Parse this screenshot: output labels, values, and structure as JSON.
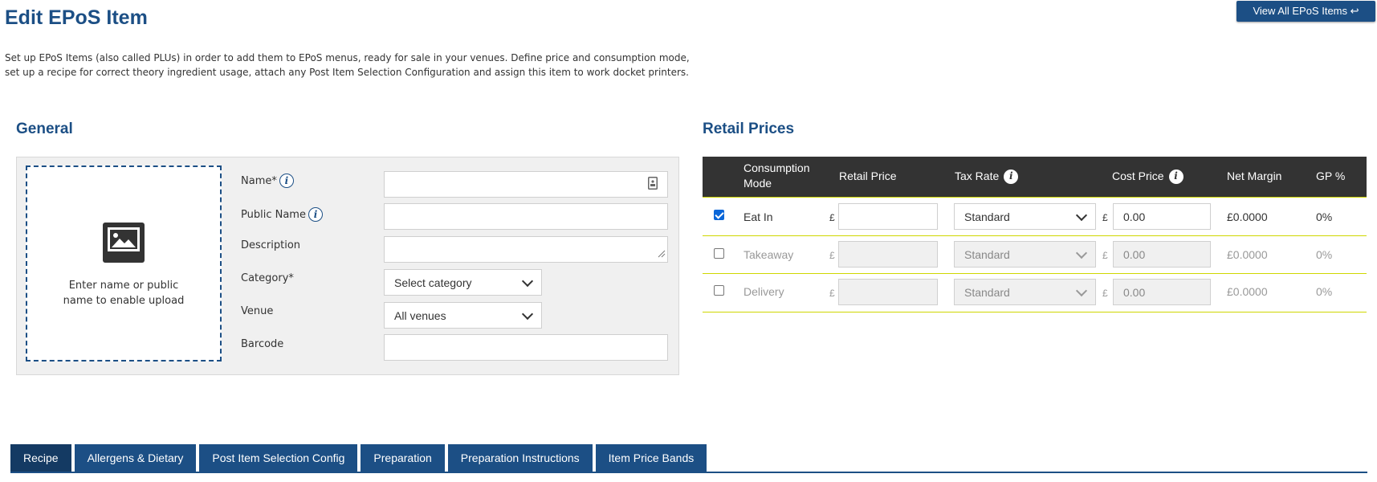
{
  "page": {
    "title": "Edit EPoS Item",
    "view_all_label": "View All EPoS Items ↩",
    "intro_line1": "Set up EPoS Items (also called PLUs) in order to add them to EPoS menus, ready for sale in your venues. Define price and consumption mode,",
    "intro_line2": "set up a recipe for correct theory ingredient usage, attach any Post Item Selection Configuration and assign this item to work docket printers."
  },
  "general": {
    "title": "General",
    "upload_line1": "Enter name or public",
    "upload_line2": "name to enable upload",
    "fields": {
      "name_label": "Name*",
      "public_name_label": "Public Name",
      "description_label": "Description",
      "category_label": "Category*",
      "venue_label": "Venue",
      "barcode_label": "Barcode",
      "category_value": "Select category",
      "venue_value": "All venues"
    }
  },
  "retail": {
    "title": "Retail Prices",
    "headers": {
      "mode_line1": "Consumption",
      "mode_line2": "Mode",
      "retail_price": "Retail Price",
      "tax_rate": "Tax Rate",
      "cost_price": "Cost Price",
      "net_margin": "Net Margin",
      "gp": "GP %"
    },
    "currency": "£",
    "rows": [
      {
        "mode": "Eat In",
        "checked": true,
        "tax": "Standard",
        "cost": "0.00",
        "margin": "£0.0000",
        "gp": "0%"
      },
      {
        "mode": "Takeaway",
        "checked": false,
        "tax": "Standard",
        "cost": "0.00",
        "margin": "£0.0000",
        "gp": "0%"
      },
      {
        "mode": "Delivery",
        "checked": false,
        "tax": "Standard",
        "cost": "0.00",
        "margin": "£0.0000",
        "gp": "0%"
      }
    ]
  },
  "tabs": [
    {
      "label": "Recipe"
    },
    {
      "label": "Allergens & Dietary"
    },
    {
      "label": "Post Item Selection Config"
    },
    {
      "label": "Preparation"
    },
    {
      "label": "Preparation Instructions"
    },
    {
      "label": "Item Price Bands"
    }
  ],
  "colors": {
    "brand": "#1c4f85",
    "header_dark": "#333333",
    "row_separator": "#cfd700",
    "checkbox": "#0a66d8"
  }
}
